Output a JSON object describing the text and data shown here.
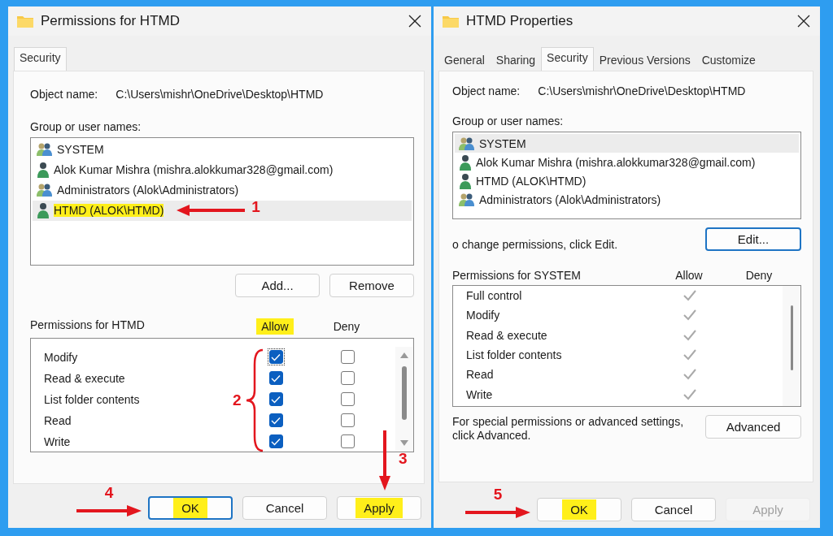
{
  "permissions_dialog": {
    "title": "Permissions for HTMD",
    "tabs": [
      {
        "label": "Security",
        "selected": true
      }
    ],
    "object_name_label": "Object name:",
    "object_name": "C:\\Users\\mishr\\OneDrive\\Desktop\\HTMD",
    "group_label": "Group or user names:",
    "principals": [
      {
        "name": "SYSTEM",
        "kind": "group",
        "selected": false,
        "highlighted": false
      },
      {
        "name": "Alok Kumar Mishra (mishra.alokkumar328@gmail.com)",
        "kind": "user",
        "selected": false,
        "highlighted": false
      },
      {
        "name": "Administrators (Alok\\Administrators)",
        "kind": "group",
        "selected": false,
        "highlighted": false
      },
      {
        "name": "HTMD (ALOK\\HTMD)",
        "kind": "user",
        "selected": true,
        "highlighted": true,
        "annotation": {
          "number": "1",
          "kind": "left"
        }
      }
    ],
    "list_buttons": [
      {
        "label": "Add...",
        "default": false,
        "disabled": false,
        "highlighted": false
      },
      {
        "label": "Remove",
        "default": false,
        "disabled": false,
        "highlighted": false
      }
    ],
    "permissions_label": "Permissions for HTMD",
    "allow_label": "Allow",
    "allow_highlighted": true,
    "deny_label": "Deny",
    "permissions_annotation": {
      "number": "2",
      "kind": "brace"
    },
    "permissions": [
      {
        "name": "Modify",
        "allow": true,
        "deny": false,
        "focused": true
      },
      {
        "name": "Read & execute",
        "allow": true,
        "deny": false,
        "focused": false
      },
      {
        "name": "List folder contents",
        "allow": true,
        "deny": false,
        "focused": false
      },
      {
        "name": "Read",
        "allow": true,
        "deny": false,
        "focused": false
      },
      {
        "name": "Write",
        "allow": true,
        "deny": false,
        "focused": false
      }
    ],
    "buttons": [
      {
        "label": "OK",
        "default": true,
        "disabled": false,
        "highlighted": true,
        "annotation": {
          "number": "4",
          "kind": "right"
        }
      },
      {
        "label": "Cancel",
        "default": false,
        "disabled": false,
        "highlighted": false
      },
      {
        "label": "Apply",
        "default": false,
        "disabled": false,
        "highlighted": true,
        "annotation": {
          "number": "3",
          "kind": "down"
        }
      }
    ]
  },
  "properties_dialog": {
    "title": "HTMD Properties",
    "tabs": [
      {
        "label": "General",
        "selected": false
      },
      {
        "label": "Sharing",
        "selected": false
      },
      {
        "label": "Security",
        "selected": true
      },
      {
        "label": "Previous Versions",
        "selected": false
      },
      {
        "label": "Customize",
        "selected": false
      }
    ],
    "object_name_label": "Object name:",
    "object_name": "C:\\Users\\mishr\\OneDrive\\Desktop\\HTMD",
    "group_label": "Group or user names:",
    "principals": [
      {
        "name": "SYSTEM",
        "kind": "group",
        "selected": true,
        "highlighted": false
      },
      {
        "name": "Alok Kumar Mishra (mishra.alokkumar328@gmail.com)",
        "kind": "user",
        "selected": false,
        "highlighted": false
      },
      {
        "name": "HTMD (ALOK\\HTMD)",
        "kind": "user",
        "selected": false,
        "highlighted": false
      },
      {
        "name": "Administrators (Alok\\Administrators)",
        "kind": "group",
        "selected": false,
        "highlighted": false
      }
    ],
    "change_hint": "o change permissions, click Edit.",
    "edit_button": {
      "label": "Edit...",
      "default": true,
      "disabled": false,
      "highlighted": false
    },
    "permissions_label": "Permissions for SYSTEM",
    "allow_label": "Allow",
    "deny_label": "Deny",
    "permissions": [
      {
        "name": "Full control",
        "allow": true
      },
      {
        "name": "Modify",
        "allow": true
      },
      {
        "name": "Read & execute",
        "allow": true
      },
      {
        "name": "List folder contents",
        "allow": true
      },
      {
        "name": "Read",
        "allow": true
      },
      {
        "name": "Write",
        "allow": true
      }
    ],
    "advanced_hint": "For special permissions or advanced settings, click Advanced.",
    "advanced_button": {
      "label": "Advanced",
      "default": false,
      "disabled": false,
      "highlighted": false
    },
    "buttons": [
      {
        "label": "OK",
        "default": false,
        "disabled": false,
        "highlighted": true,
        "annotation": {
          "number": "5",
          "kind": "right"
        }
      },
      {
        "label": "Cancel",
        "default": false,
        "disabled": false,
        "highlighted": false
      },
      {
        "label": "Apply",
        "default": false,
        "disabled": true,
        "highlighted": false
      }
    ]
  }
}
